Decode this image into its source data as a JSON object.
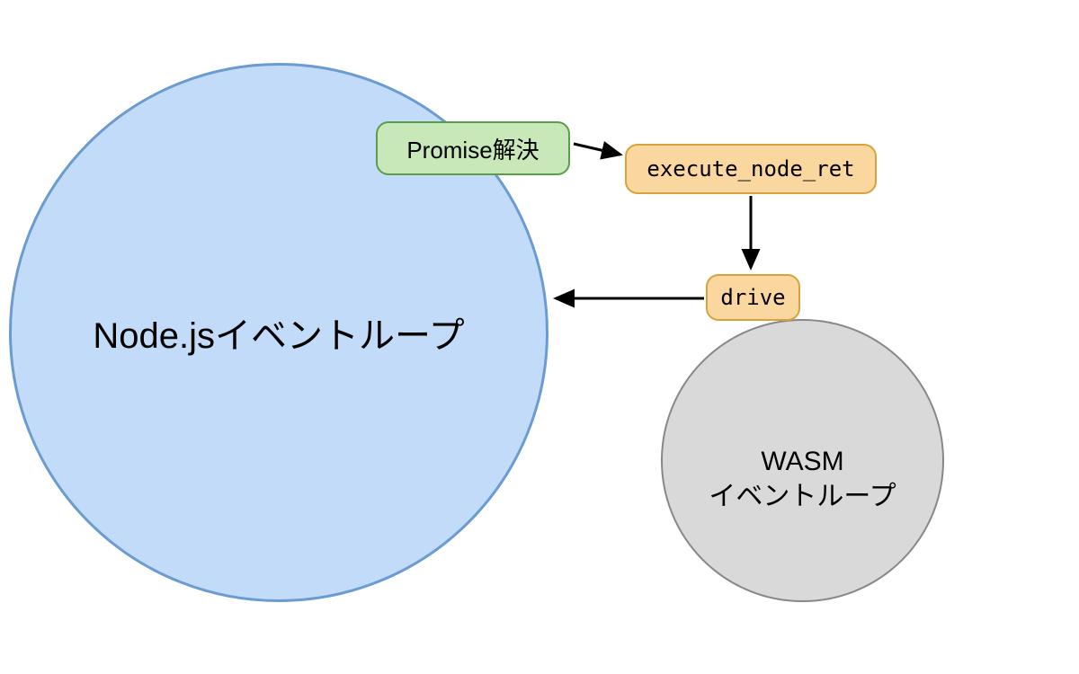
{
  "nodes": {
    "nodejs_loop": "Node.jsイベントループ",
    "wasm_loop_line1": "WASM",
    "wasm_loop_line2": "イベントループ",
    "promise_resolve": "Promise解決",
    "execute_node_ret": "execute_node_ret",
    "drive": "drive"
  },
  "colors": {
    "large_circle_fill": "#c2dbf8",
    "large_circle_stroke": "#6a9bd1",
    "small_circle_fill": "#d9d9d9",
    "small_circle_stroke": "#888888",
    "green_box_fill": "#c9e8b9",
    "green_box_stroke": "#5a9e4a",
    "orange_box_fill": "#fad79f",
    "orange_box_stroke": "#d9a23c"
  },
  "edges": [
    {
      "from": "promise_resolve",
      "to": "execute_node_ret"
    },
    {
      "from": "execute_node_ret",
      "to": "drive"
    },
    {
      "from": "drive",
      "to": "nodejs_loop"
    }
  ]
}
